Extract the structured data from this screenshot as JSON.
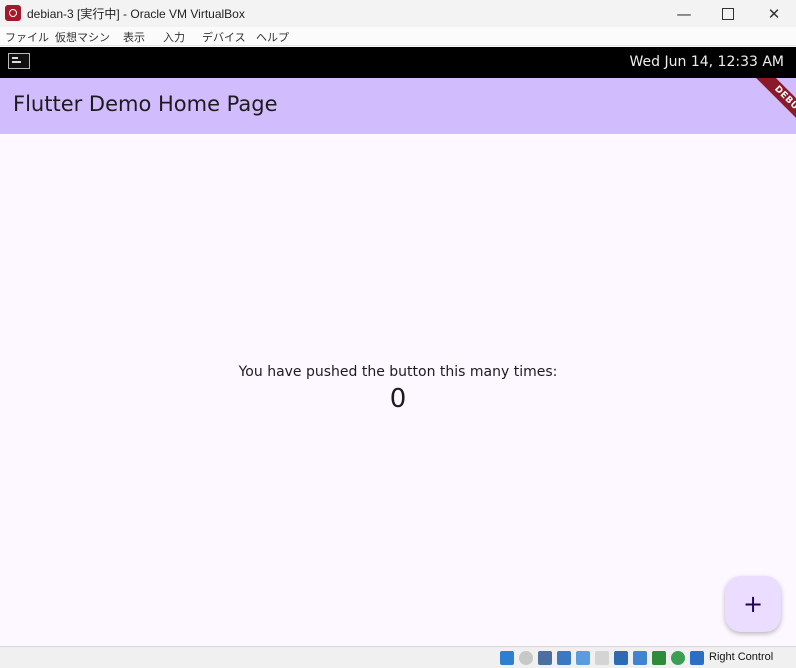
{
  "window": {
    "title": "debian-3 [実行中] - Oracle VM VirtualBox",
    "minimize_glyph": "—",
    "close_glyph": "✕"
  },
  "menu": [
    "ファイル",
    "仮想マシン",
    "表示",
    "入力",
    "デバイス",
    "ヘルプ"
  ],
  "guest_panel": {
    "clock": "Wed Jun 14, 12:33 AM"
  },
  "app": {
    "title": "Flutter Demo Home Page",
    "debug_banner": "DEBUG",
    "counter_label": "You have pushed the button this many times:",
    "counter_value": "0",
    "fab_glyph": "+"
  },
  "statusbar": {
    "host_key": "Right Control",
    "icons": [
      "hard-disk-icon",
      "optical-drive-icon",
      "audio-icon",
      "network-icon",
      "usb-icon",
      "shared-folders-icon",
      "display-icon",
      "video-capture-icon",
      "recording-icon",
      "cpu-icon",
      "mouse-integration-icon",
      "keyboard-capture-icon"
    ]
  },
  "colors": {
    "appbar": "#d1bcfd",
    "fab": "#eaddff",
    "background": "#fdf7ff",
    "debug": "#8a1a2a"
  }
}
